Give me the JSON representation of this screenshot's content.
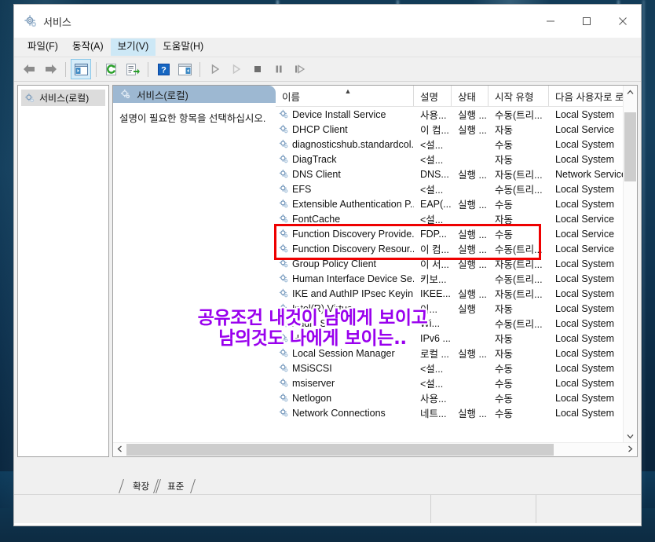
{
  "window": {
    "title": "서비스",
    "icon": "services-gear-icon",
    "controls": {
      "minimize": "minimize-icon",
      "maximize": "maximize-icon",
      "close": "close-icon"
    }
  },
  "menu": {
    "items": [
      {
        "label": "파일(F)",
        "highlighted": false
      },
      {
        "label": "동작(A)",
        "highlighted": false
      },
      {
        "label": "보기(V)",
        "highlighted": true
      },
      {
        "label": "도움말(H)",
        "highlighted": false
      }
    ]
  },
  "toolbar": {
    "buttons": [
      {
        "name": "back-arrow-icon",
        "selected": false
      },
      {
        "name": "forward-arrow-icon",
        "selected": false
      },
      {
        "name": "show-hide-tree-icon",
        "selected": true
      },
      {
        "name": "refresh-icon",
        "selected": false
      },
      {
        "name": "export-list-icon",
        "selected": false
      },
      {
        "name": "help-icon",
        "selected": false
      },
      {
        "name": "properties-icon",
        "selected": false
      },
      {
        "name": "start-service-icon",
        "selected": false
      },
      {
        "name": "resume-service-icon",
        "selected": false
      },
      {
        "name": "stop-service-icon",
        "selected": false
      },
      {
        "name": "pause-service-icon",
        "selected": false
      },
      {
        "name": "restart-service-icon",
        "selected": false
      }
    ]
  },
  "tree": {
    "root_label": "서비스(로컬)"
  },
  "detail": {
    "header": "서비스(로컬)",
    "message": "설명이 필요한 항목을 선택하십시오."
  },
  "list": {
    "columns": [
      {
        "label": "이름",
        "sorted": true,
        "sort_arrow": "▲"
      },
      {
        "label": "설명",
        "sorted": false,
        "sort_arrow": ""
      },
      {
        "label": "상태",
        "sorted": false,
        "sort_arrow": ""
      },
      {
        "label": "시작 유형",
        "sorted": false,
        "sort_arrow": ""
      },
      {
        "label": "다음 사용자로 로",
        "sorted": false,
        "sort_arrow": ""
      }
    ],
    "rows": [
      {
        "name": "Device Install Service",
        "desc": "사용...",
        "status": "실행 ...",
        "startup": "수동(트리...",
        "logon": "Local System",
        "obscured": false
      },
      {
        "name": "DHCP Client",
        "desc": "이 컴...",
        "status": "실행 ...",
        "startup": "자동",
        "logon": "Local Service",
        "obscured": false
      },
      {
        "name": "diagnosticshub.standardcol...",
        "desc": "<설...",
        "status": "",
        "startup": "수동",
        "logon": "Local System",
        "obscured": false
      },
      {
        "name": "DiagTrack",
        "desc": "<설...",
        "status": "",
        "startup": "자동",
        "logon": "Local System",
        "obscured": false
      },
      {
        "name": "DNS Client",
        "desc": "DNS...",
        "status": "실행 ...",
        "startup": "자동(트리...",
        "logon": "Network Service",
        "obscured": false
      },
      {
        "name": "EFS",
        "desc": "<설...",
        "status": "",
        "startup": "수동(트리...",
        "logon": "Local System",
        "obscured": false
      },
      {
        "name": "Extensible Authentication P...",
        "desc": "EAP(...",
        "status": "실행 ...",
        "startup": "수동",
        "logon": "Local System",
        "obscured": false
      },
      {
        "name": "FontCache",
        "desc": "<설...",
        "status": "",
        "startup": "자동",
        "logon": "Local Service",
        "obscured": false
      },
      {
        "name": "Function Discovery Provide...",
        "desc": "FDP...",
        "status": "실행 ...",
        "startup": "수동",
        "logon": "Local Service",
        "obscured": false
      },
      {
        "name": "Function Discovery Resour...",
        "desc": "이 컴...",
        "status": "실행 ...",
        "startup": "수동(트리...",
        "logon": "Local Service",
        "obscured": false
      },
      {
        "name": "Group Policy Client",
        "desc": "이 서...",
        "status": "실행 ...",
        "startup": "자동(트리...",
        "logon": "Local System",
        "obscured": false
      },
      {
        "name": "Human Interface Device Se...",
        "desc": "키보...",
        "status": "",
        "startup": "수동(트리...",
        "logon": "Local System",
        "obscured": false
      },
      {
        "name": "IKE and AuthIP IPsec Keyin...",
        "desc": "IKEE...",
        "status": "실행 ...",
        "startup": "자동(트리...",
        "logon": "Local System",
        "obscured": true
      },
      {
        "name": "Intel(R) Virtua...",
        "desc": "이...",
        "status": "실행",
        "startup": "자동",
        "logon": "Local System",
        "obscured": true
      },
      {
        "name": "Audio S...",
        "desc": "Wi...",
        "status": "",
        "startup": "수동(트리...",
        "logon": "Local System",
        "obscured": true
      },
      {
        "name": "Helper",
        "desc": "IPv6 ...",
        "status": "",
        "startup": "자동",
        "logon": "Local System",
        "obscured": true
      },
      {
        "name": "Local Session Manager",
        "desc": "로컬 ...",
        "status": "실행 ...",
        "startup": "자동",
        "logon": "Local System",
        "obscured": false
      },
      {
        "name": "MSiSCSI",
        "desc": "<설...",
        "status": "",
        "startup": "수동",
        "logon": "Local System",
        "obscured": false
      },
      {
        "name": "msiserver",
        "desc": "<설...",
        "status": "",
        "startup": "수동",
        "logon": "Local System",
        "obscured": false
      },
      {
        "name": "Netlogon",
        "desc": "사용...",
        "status": "",
        "startup": "수동",
        "logon": "Local System",
        "obscured": false
      },
      {
        "name": "Network Connections",
        "desc": "네트...",
        "status": "실행 ...",
        "startup": "수동",
        "logon": "Local System",
        "obscured": false
      }
    ]
  },
  "annotation": {
    "highlight_color": "#ee0000",
    "highlight_rows": [
      "Function Discovery Provide...",
      "Function Discovery Resour..."
    ],
    "caption_color": "#9900ee",
    "caption_outline_color": "#ffffff",
    "caption_line1": "공유조건  내것이 남에게 보이고",
    "caption_line2": "남의것도 나에게 보이는.."
  },
  "tabs": [
    {
      "label": "확장",
      "active": false
    },
    {
      "label": "표준",
      "active": true
    }
  ]
}
